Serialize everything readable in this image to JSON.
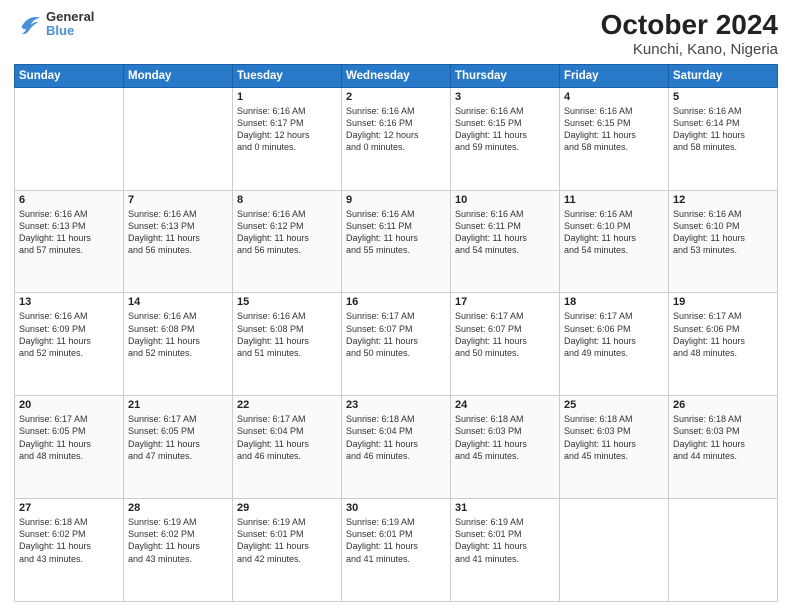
{
  "header": {
    "logo": {
      "line1": "General",
      "line2": "Blue"
    },
    "title": "October 2024",
    "subtitle": "Kunchi, Kano, Nigeria"
  },
  "weekdays": [
    "Sunday",
    "Monday",
    "Tuesday",
    "Wednesday",
    "Thursday",
    "Friday",
    "Saturday"
  ],
  "weeks": [
    [
      {
        "day": "",
        "content": ""
      },
      {
        "day": "",
        "content": ""
      },
      {
        "day": "1",
        "content": "Sunrise: 6:16 AM\nSunset: 6:17 PM\nDaylight: 12 hours\nand 0 minutes."
      },
      {
        "day": "2",
        "content": "Sunrise: 6:16 AM\nSunset: 6:16 PM\nDaylight: 12 hours\nand 0 minutes."
      },
      {
        "day": "3",
        "content": "Sunrise: 6:16 AM\nSunset: 6:15 PM\nDaylight: 11 hours\nand 59 minutes."
      },
      {
        "day": "4",
        "content": "Sunrise: 6:16 AM\nSunset: 6:15 PM\nDaylight: 11 hours\nand 58 minutes."
      },
      {
        "day": "5",
        "content": "Sunrise: 6:16 AM\nSunset: 6:14 PM\nDaylight: 11 hours\nand 58 minutes."
      }
    ],
    [
      {
        "day": "6",
        "content": "Sunrise: 6:16 AM\nSunset: 6:13 PM\nDaylight: 11 hours\nand 57 minutes."
      },
      {
        "day": "7",
        "content": "Sunrise: 6:16 AM\nSunset: 6:13 PM\nDaylight: 11 hours\nand 56 minutes."
      },
      {
        "day": "8",
        "content": "Sunrise: 6:16 AM\nSunset: 6:12 PM\nDaylight: 11 hours\nand 56 minutes."
      },
      {
        "day": "9",
        "content": "Sunrise: 6:16 AM\nSunset: 6:11 PM\nDaylight: 11 hours\nand 55 minutes."
      },
      {
        "day": "10",
        "content": "Sunrise: 6:16 AM\nSunset: 6:11 PM\nDaylight: 11 hours\nand 54 minutes."
      },
      {
        "day": "11",
        "content": "Sunrise: 6:16 AM\nSunset: 6:10 PM\nDaylight: 11 hours\nand 54 minutes."
      },
      {
        "day": "12",
        "content": "Sunrise: 6:16 AM\nSunset: 6:10 PM\nDaylight: 11 hours\nand 53 minutes."
      }
    ],
    [
      {
        "day": "13",
        "content": "Sunrise: 6:16 AM\nSunset: 6:09 PM\nDaylight: 11 hours\nand 52 minutes."
      },
      {
        "day": "14",
        "content": "Sunrise: 6:16 AM\nSunset: 6:08 PM\nDaylight: 11 hours\nand 52 minutes."
      },
      {
        "day": "15",
        "content": "Sunrise: 6:16 AM\nSunset: 6:08 PM\nDaylight: 11 hours\nand 51 minutes."
      },
      {
        "day": "16",
        "content": "Sunrise: 6:17 AM\nSunset: 6:07 PM\nDaylight: 11 hours\nand 50 minutes."
      },
      {
        "day": "17",
        "content": "Sunrise: 6:17 AM\nSunset: 6:07 PM\nDaylight: 11 hours\nand 50 minutes."
      },
      {
        "day": "18",
        "content": "Sunrise: 6:17 AM\nSunset: 6:06 PM\nDaylight: 11 hours\nand 49 minutes."
      },
      {
        "day": "19",
        "content": "Sunrise: 6:17 AM\nSunset: 6:06 PM\nDaylight: 11 hours\nand 48 minutes."
      }
    ],
    [
      {
        "day": "20",
        "content": "Sunrise: 6:17 AM\nSunset: 6:05 PM\nDaylight: 11 hours\nand 48 minutes."
      },
      {
        "day": "21",
        "content": "Sunrise: 6:17 AM\nSunset: 6:05 PM\nDaylight: 11 hours\nand 47 minutes."
      },
      {
        "day": "22",
        "content": "Sunrise: 6:17 AM\nSunset: 6:04 PM\nDaylight: 11 hours\nand 46 minutes."
      },
      {
        "day": "23",
        "content": "Sunrise: 6:18 AM\nSunset: 6:04 PM\nDaylight: 11 hours\nand 46 minutes."
      },
      {
        "day": "24",
        "content": "Sunrise: 6:18 AM\nSunset: 6:03 PM\nDaylight: 11 hours\nand 45 minutes."
      },
      {
        "day": "25",
        "content": "Sunrise: 6:18 AM\nSunset: 6:03 PM\nDaylight: 11 hours\nand 45 minutes."
      },
      {
        "day": "26",
        "content": "Sunrise: 6:18 AM\nSunset: 6:03 PM\nDaylight: 11 hours\nand 44 minutes."
      }
    ],
    [
      {
        "day": "27",
        "content": "Sunrise: 6:18 AM\nSunset: 6:02 PM\nDaylight: 11 hours\nand 43 minutes."
      },
      {
        "day": "28",
        "content": "Sunrise: 6:19 AM\nSunset: 6:02 PM\nDaylight: 11 hours\nand 43 minutes."
      },
      {
        "day": "29",
        "content": "Sunrise: 6:19 AM\nSunset: 6:01 PM\nDaylight: 11 hours\nand 42 minutes."
      },
      {
        "day": "30",
        "content": "Sunrise: 6:19 AM\nSunset: 6:01 PM\nDaylight: 11 hours\nand 41 minutes."
      },
      {
        "day": "31",
        "content": "Sunrise: 6:19 AM\nSunset: 6:01 PM\nDaylight: 11 hours\nand 41 minutes."
      },
      {
        "day": "",
        "content": ""
      },
      {
        "day": "",
        "content": ""
      }
    ]
  ]
}
